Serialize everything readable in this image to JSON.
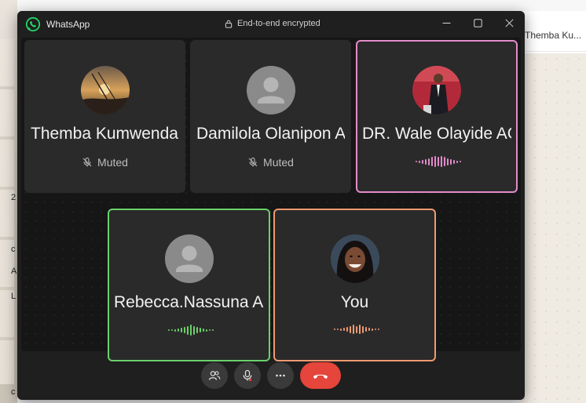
{
  "window": {
    "app_title": "WhatsApp",
    "encryption_label": "End-to-end encrypted",
    "controls": [
      "minimize-icon",
      "maximize-icon",
      "close-icon"
    ]
  },
  "background": {
    "chat_header_name": "Themba Ku...",
    "left_chars": [
      "2",
      "c",
      "A",
      "L",
      "c"
    ]
  },
  "participants": [
    {
      "name": "Themba Kumwenda AG",
      "status": "Muted",
      "avatar": "photo-sunset",
      "speaking": false
    },
    {
      "name": "Damilola Olanipon AG",
      "status": "Muted",
      "avatar": "placeholder",
      "speaking": false
    },
    {
      "name": "DR. Wale Olayide AG",
      "status": "",
      "avatar": "photo-man-suit",
      "speaking": true,
      "accent": "#e38bcb"
    },
    {
      "name": "Rebecca.Nassuna AG",
      "status": "",
      "avatar": "placeholder",
      "speaking": true,
      "accent": "#6ad16a"
    },
    {
      "name": "You",
      "status": "",
      "avatar": "photo-woman",
      "speaking": true,
      "accent": "#f09a72"
    }
  ],
  "call_controls": {
    "buttons": [
      "participants-icon",
      "microphone-icon",
      "more-icon",
      "end-call-icon"
    ],
    "end_call_color": "#e5453a"
  },
  "colors": {
    "window_bg": "#1f1f1f",
    "tile_bg": "#2a2a2a",
    "whatsapp_green": "#25d366"
  }
}
